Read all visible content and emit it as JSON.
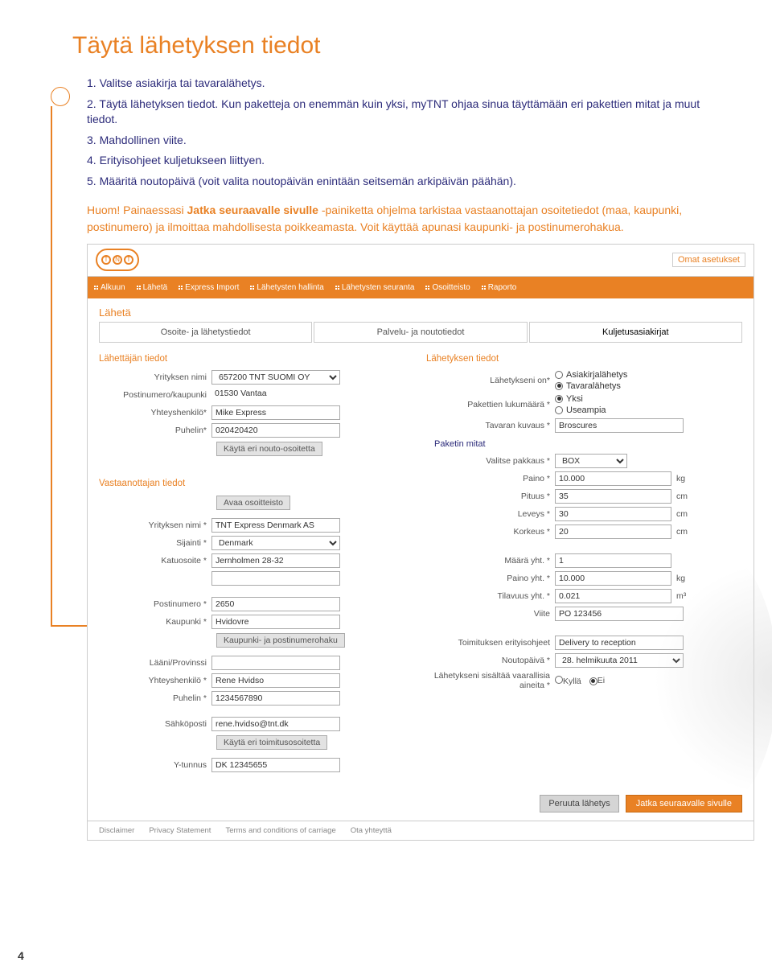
{
  "page": {
    "title": "Täytä lähetyksen tiedot",
    "page_number": "4",
    "steps": [
      "1. Valitse asiakirja tai tavaralähetys.",
      "2. Täytä lähetyksen tiedot. Kun paketteja on enemmän kuin yksi, myTNT ohjaa sinua täyttämään eri pakettien mitat ja muut tiedot.",
      "3. Mahdollinen viite.",
      "4. Erityisohjeet kuljetukseen liittyen.",
      "5. Määritä noutopäivä (voit valita noutopäivän enintään seitsemän arkipäivän päähän)."
    ],
    "note_prefix": "Huom! Painaessasi ",
    "note_bold": "Jatka seuraavalle sivulle",
    "note_suffix": " -painiketta ohjelma tarkistaa vastaanottajan osoitetiedot (maa, kaupunki, postinumero) ja ilmoittaa mahdollisesta poikkeamasta. Voit käyttää apunasi kaupunki- ja postinumerohakua."
  },
  "app": {
    "settings_link": "Omat asetukset",
    "nav": [
      "Alkuun",
      "Lähetä",
      "Express Import",
      "Lähetysten hallinta",
      "Lähetysten seuranta",
      "Osoitteisto",
      "Raporto"
    ],
    "send_header": "Lähetä",
    "tabs": {
      "t1": "Osoite- ja lähetystiedot",
      "t2": "Palvelu- ja noutotiedot",
      "t3": "Kuljetusasiakirjat"
    },
    "sender": {
      "title": "Lähettäjän tiedot",
      "labels": {
        "company": "Yrityksen nimi",
        "postal_city": "Postinumero/kaupunki",
        "contact": "Yhteyshenkilö*",
        "phone": "Puhelin*"
      },
      "values": {
        "company": "657200 TNT SUOMI OY",
        "postal_city": "01530 Vantaa",
        "contact": "Mike Express",
        "phone": "020420420"
      },
      "alt_pickup_btn": "Käytä eri nouto-osoitetta"
    },
    "receiver": {
      "title": "Vastaanottajan tiedot",
      "open_address_btn": "Avaa osoitteisto",
      "labels": {
        "company": "Yrityksen nimi *",
        "country": "Sijainti *",
        "street": "Katuosoite *",
        "postal": "Postinumero *",
        "city": "Kaupunki *",
        "lookup": "Kaupunki- ja postinumerohaku",
        "province": "Lääni/Provinssi",
        "contact": "Yhteyshenkilö *",
        "phone": "Puhelin *",
        "email": "Sähköposti",
        "alt_delivery_btn": "Käytä eri toimitusosoitetta",
        "vat": "Y-tunnus"
      },
      "values": {
        "company": "TNT Express Denmark AS",
        "country": "Denmark",
        "street": "Jernholmen 28-32",
        "postal": "2650",
        "city": "Hvidovre",
        "contact": "Rene Hvidso",
        "phone": "1234567890",
        "email": "rene.hvidso@tnt.dk",
        "vat": "DK 12345655"
      }
    },
    "shipment": {
      "title": "Lähetyksen tiedot",
      "labels": {
        "type": "Lähetykseni on*",
        "type_doc": "Asiakirjalähetys",
        "type_goods": "Tavaralähetys",
        "pkg_count": "Pakettien lukumäärä *",
        "qty_one": "Yksi",
        "qty_more": "Useampia",
        "goods_desc": "Tavaran kuvaus *",
        "dims_title": "Paketin mitat",
        "pkg_select": "Valitse pakkaus *",
        "weight": "Paino *",
        "length": "Pituus *",
        "width": "Leveys *",
        "height": "Korkeus *",
        "qty_total": "Määrä yht. *",
        "weight_total": "Paino yht. *",
        "volume_total": "Tilavuus yht. *",
        "reference": "Viite",
        "instructions": "Toimituksen erityisohjeet",
        "pickup_date": "Noutopäivä *",
        "dangerous": "Lähetykseni sisältää vaarallisia aineita *",
        "yes": "Kyllä",
        "no": "Ei"
      },
      "values": {
        "goods_desc": "Broscures",
        "pkg_select": "BOX",
        "weight": "10.000",
        "length": "35",
        "width": "30",
        "height": "20",
        "qty_total": "1",
        "weight_total": "10.000",
        "volume_total": "0.021",
        "reference": "PO 123456",
        "instructions": "Delivery to reception",
        "pickup_date": "28. helmikuuta 2011"
      },
      "units": {
        "kg": "kg",
        "cm": "cm",
        "m3": "m³"
      }
    },
    "actions": {
      "cancel": "Peruuta lähetys",
      "next": "Jatka seuraavalle sivulle"
    },
    "footer": [
      "Disclaimer",
      "Privacy Statement",
      "Terms and conditions of carriage",
      "Ota yhteyttä"
    ]
  }
}
